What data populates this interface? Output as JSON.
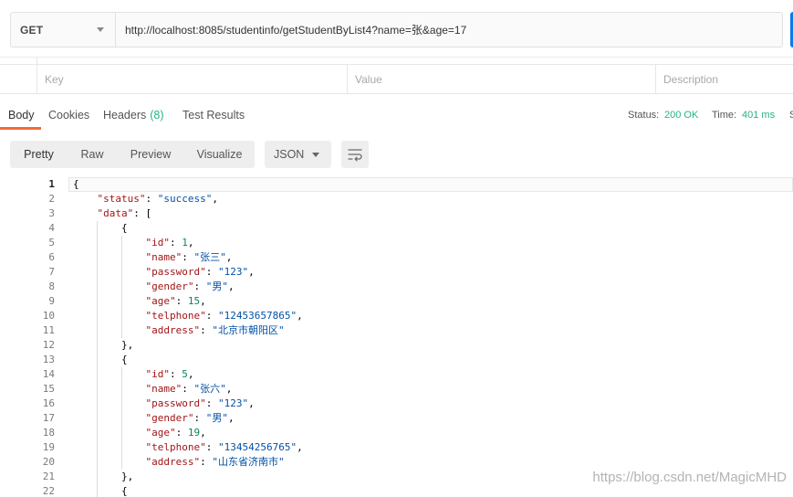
{
  "request": {
    "method": "GET",
    "url": "http://localhost:8085/studentinfo/getStudentByList4?name=张&age=17"
  },
  "params_table": {
    "placeholders": {
      "key": "Key",
      "value": "Value",
      "description": "Description"
    }
  },
  "response_tabs": {
    "items": [
      {
        "label": "Body"
      },
      {
        "label": "Cookies"
      },
      {
        "label": "Headers",
        "count": "(8)"
      },
      {
        "label": "Test Results"
      }
    ],
    "active_index": 0
  },
  "response_meta": {
    "status_label": "Status:",
    "status_value": "200 OK",
    "time_label": "Time:",
    "time_value": "401 ms",
    "size_label": "S"
  },
  "viewer": {
    "modes": [
      "Pretty",
      "Raw",
      "Preview",
      "Visualize"
    ],
    "active_index": 0,
    "language": "JSON"
  },
  "editor": {
    "active_line": 1,
    "lines": [
      {
        "n": "1",
        "text": "{"
      },
      {
        "n": "2",
        "text": "    \"status\": \"success\","
      },
      {
        "n": "3",
        "text": "    \"data\": ["
      },
      {
        "n": "4",
        "text": "        {"
      },
      {
        "n": "5",
        "text": "            \"id\": 1,"
      },
      {
        "n": "6",
        "text": "            \"name\": \"张三\","
      },
      {
        "n": "7",
        "text": "            \"password\": \"123\","
      },
      {
        "n": "8",
        "text": "            \"gender\": \"男\","
      },
      {
        "n": "9",
        "text": "            \"age\": 15,"
      },
      {
        "n": "10",
        "text": "            \"telphone\": \"12453657865\","
      },
      {
        "n": "11",
        "text": "            \"address\": \"北京市朝阳区\""
      },
      {
        "n": "12",
        "text": "        },"
      },
      {
        "n": "13",
        "text": "        {"
      },
      {
        "n": "14",
        "text": "            \"id\": 5,"
      },
      {
        "n": "15",
        "text": "            \"name\": \"张六\","
      },
      {
        "n": "16",
        "text": "            \"password\": \"123\","
      },
      {
        "n": "17",
        "text": "            \"gender\": \"男\","
      },
      {
        "n": "18",
        "text": "            \"age\": 19,"
      },
      {
        "n": "19",
        "text": "            \"telphone\": \"13454256765\","
      },
      {
        "n": "20",
        "text": "            \"address\": \"山东省济南市\""
      },
      {
        "n": "21",
        "text": "        },"
      },
      {
        "n": "22",
        "text": "        {"
      }
    ]
  },
  "watermark": "https://blog.csdn.net/MagicMHD",
  "icons": {
    "method_dropdown": "chevron-down-icon",
    "language_dropdown": "caret-down-icon",
    "wrap_button": "wrap-lines-icon"
  },
  "colors": {
    "send_button": "#097BED",
    "active_tab_underline": "#F26B3A",
    "success_text": "#26B47F",
    "syntax_key": "#A31515",
    "syntax_string": "#0451A5",
    "syntax_number": "#098658",
    "syntax_punct": "#000000"
  }
}
